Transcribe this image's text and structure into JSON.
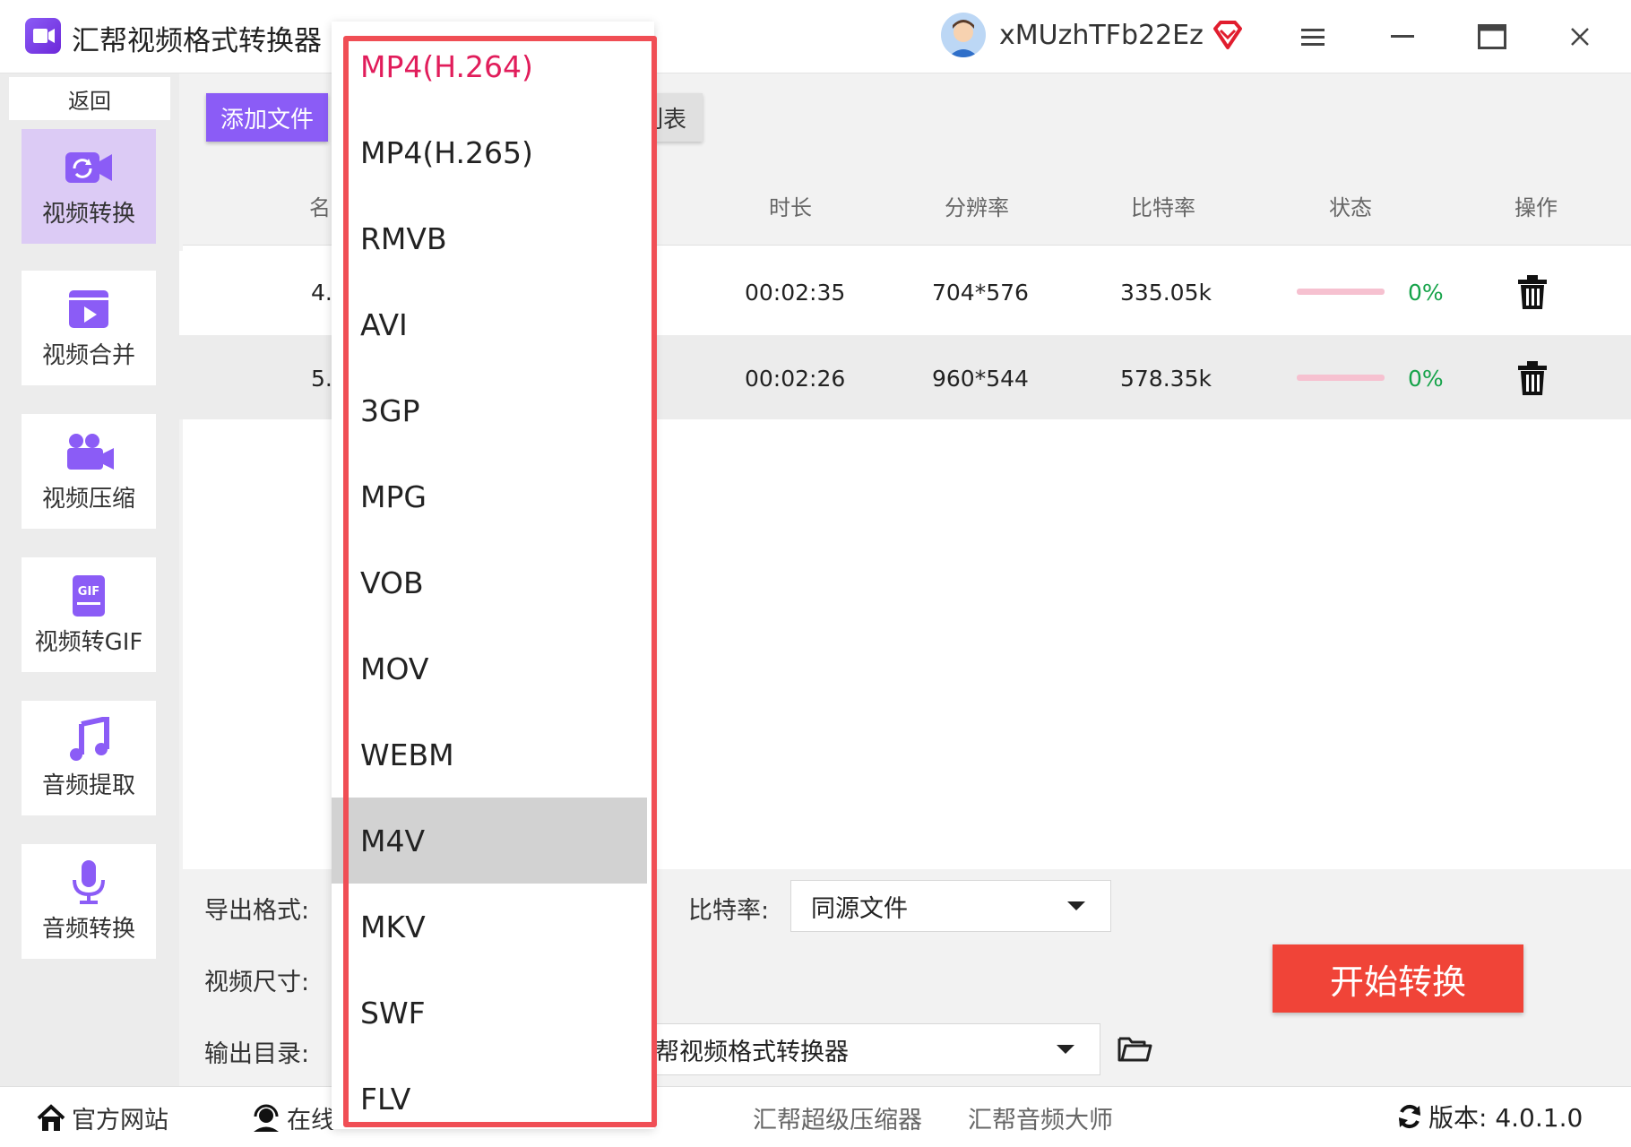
{
  "app": {
    "title": "汇帮视频格式转换器",
    "username": "xMUzhTFb22Ez"
  },
  "sidebar": {
    "back": "返回",
    "items": [
      {
        "label": "视频转换",
        "icon": "video-convert-icon"
      },
      {
        "label": "视频合并",
        "icon": "video-merge-icon"
      },
      {
        "label": "视频压缩",
        "icon": "video-compress-icon"
      },
      {
        "label": "视频转GIF",
        "icon": "gif-icon"
      },
      {
        "label": "音频提取",
        "icon": "music-note-icon"
      },
      {
        "label": "音频转换",
        "icon": "microphone-icon"
      }
    ]
  },
  "toolbar": {
    "add_files": "添加文件",
    "clear_list_partial": "列表"
  },
  "table": {
    "headers": {
      "name_partial": "名",
      "duration": "时长",
      "resolution": "分辨率",
      "bitrate": "比特率",
      "status": "状态",
      "actions": "操作"
    },
    "rows": [
      {
        "name_partial": "4.",
        "duration": "00:02:35",
        "resolution": "704*576",
        "bitrate": "335.05k",
        "progress": "0%"
      },
      {
        "name_partial": "5.",
        "duration": "00:02:26",
        "resolution": "960*544",
        "bitrate": "578.35k",
        "progress": "0%"
      }
    ]
  },
  "settings": {
    "export_format_label": "导出格式:",
    "video_size_label": "视频尺寸:",
    "output_dir_label": "输出目录:",
    "bitrate_label": "比特率:",
    "bitrate_value": "同源文件",
    "output_dir_value": "帮视频格式转换器",
    "start_button": "开始转换"
  },
  "dropdown": {
    "options": [
      "MP4(H.264)",
      "MP4(H.265)",
      "RMVB",
      "AVI",
      "3GP",
      "MPG",
      "VOB",
      "MOV",
      "WEBM",
      "M4V",
      "MKV",
      "SWF",
      "FLV"
    ],
    "selected": "MP4(H.264)",
    "hovered": "M4V"
  },
  "footer": {
    "website": "官方网站",
    "online_partial": "在线",
    "compressor": "汇帮超级压缩器",
    "audio_master": "汇帮音频大师",
    "version": "版本: 4.0.1.0"
  },
  "colors": {
    "accent": "#8b5cf6",
    "start": "#f04438",
    "highlight_border": "#f04e55",
    "success": "#16a34a",
    "selected_text": "#e11d5b"
  }
}
